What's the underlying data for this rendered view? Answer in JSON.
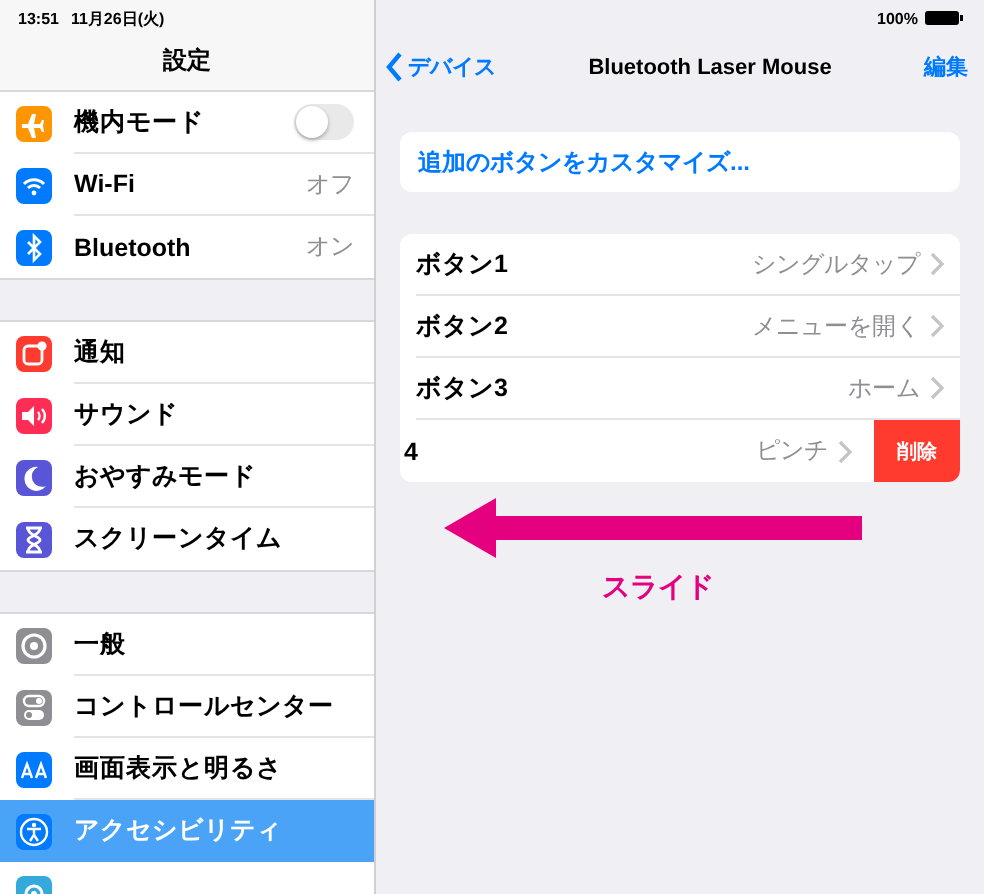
{
  "status_bar": {
    "time": "13:51",
    "date": "11月26日(火)",
    "battery": "100%"
  },
  "sidebar": {
    "title": "設定",
    "sections": [
      [
        {
          "label": "機内モード",
          "kind": "toggle",
          "on": false,
          "selected": false,
          "color": "#ff9500"
        },
        {
          "label": "Wi-Fi",
          "kind": "value",
          "value": "オフ",
          "selected": false,
          "color": "#007aff"
        },
        {
          "label": "Bluetooth",
          "kind": "value",
          "value": "オン",
          "selected": false,
          "color": "#007aff"
        }
      ],
      [
        {
          "label": "通知",
          "kind": "plain",
          "selected": false,
          "color": "#ff3b30"
        },
        {
          "label": "サウンド",
          "kind": "plain",
          "selected": false,
          "color": "#ff2d55"
        },
        {
          "label": "おやすみモード",
          "kind": "plain",
          "selected": false,
          "color": "#5856d6"
        },
        {
          "label": "スクリーンタイム",
          "kind": "plain",
          "selected": false,
          "color": "#5856d6"
        }
      ],
      [
        {
          "label": "一般",
          "kind": "plain",
          "selected": false,
          "color": "#8e8e93"
        },
        {
          "label": "コントロールセンター",
          "kind": "plain",
          "selected": false,
          "color": "#8e8e93"
        },
        {
          "label": "画面表示と明るさ",
          "kind": "plain",
          "selected": false,
          "color": "#007aff"
        },
        {
          "label": "アクセシビリティ",
          "kind": "plain",
          "selected": true,
          "color": "#007aff"
        },
        {
          "kind": "plain",
          "selected": false,
          "color": "#34aadc"
        }
      ]
    ]
  },
  "detail": {
    "back": "デバイス",
    "title": "Bluetooth Laser Mouse",
    "edit": "編集",
    "customize_link": "追加のボタンをカスタマイズ...",
    "buttons": [
      {
        "label": "ボタン1",
        "value": "シングルタップ",
        "swiped": false
      },
      {
        "label": "ボタン2",
        "value": "メニューを開く",
        "swiped": false
      },
      {
        "label": "ボタン3",
        "value": "ホーム",
        "swiped": false
      },
      {
        "label": "4",
        "value": "ピンチ",
        "swiped": true,
        "action": "削除"
      }
    ]
  },
  "annotation": {
    "label": "スライド"
  }
}
